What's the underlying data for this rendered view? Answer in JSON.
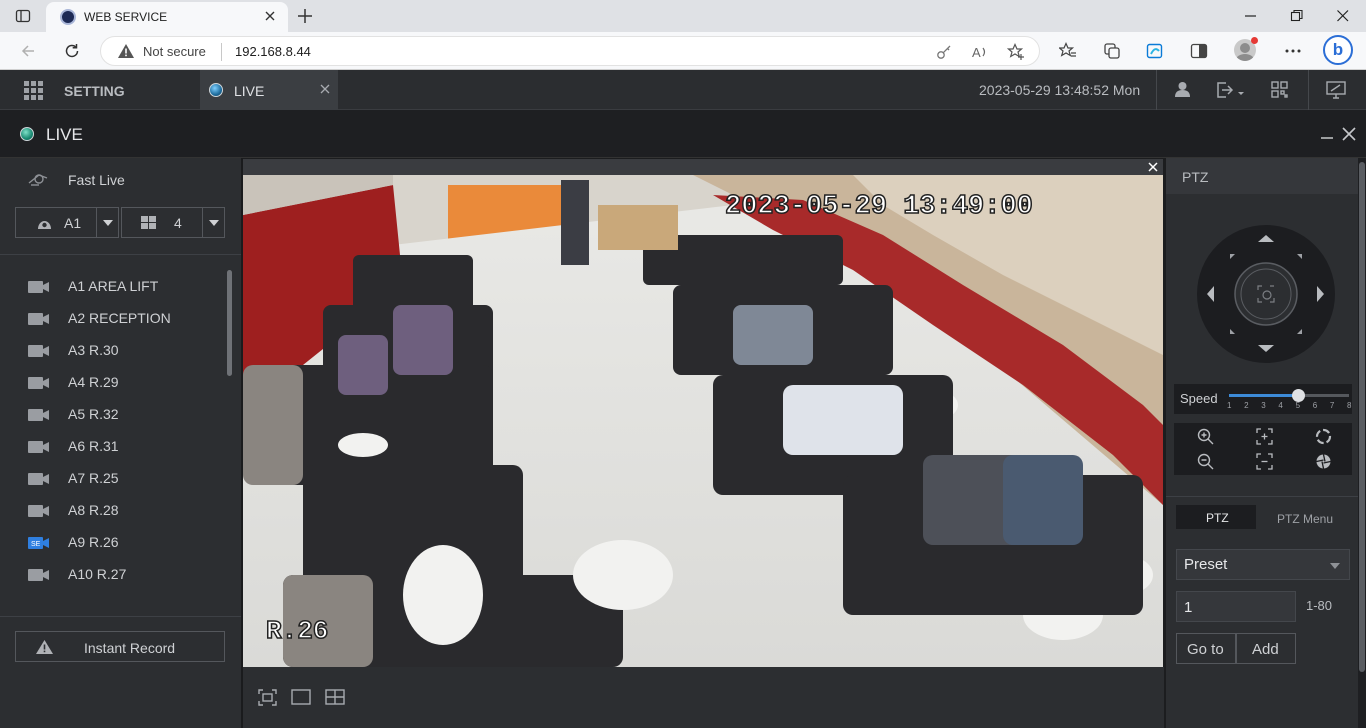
{
  "browser": {
    "tab_title": "WEB SERVICE",
    "security_label": "Not secure",
    "url": "192.168.8.44"
  },
  "app": {
    "setting_label": "SETTING",
    "live_tab_label": "LIVE",
    "datetime": "2023-05-29 13:48:52 Mon"
  },
  "live": {
    "title": "LIVE"
  },
  "left_panel": {
    "fast_live": "Fast Live",
    "area_select": "A1",
    "layout_select": "4",
    "cameras": [
      {
        "label": "A1 AREA LIFT",
        "active": false
      },
      {
        "label": "A2 RECEPTION",
        "active": false
      },
      {
        "label": "A3 R.30",
        "active": false
      },
      {
        "label": "A4 R.29",
        "active": false
      },
      {
        "label": "A5 R.32",
        "active": false
      },
      {
        "label": "A6 R.31",
        "active": false
      },
      {
        "label": "A7 R.25",
        "active": false
      },
      {
        "label": "A8 R.28",
        "active": false
      },
      {
        "label": "A9 R.26",
        "active": true
      },
      {
        "label": "A10 R.27",
        "active": false
      }
    ],
    "instant_record": "Instant Record"
  },
  "video": {
    "osd_datetime": "2023-05-29 13:49:00",
    "osd_channel": "R.26"
  },
  "ptz": {
    "title": "PTZ",
    "speed_label": "Speed",
    "speed_ticks": [
      "1",
      "2",
      "3",
      "4",
      "5",
      "6",
      "7",
      "8"
    ],
    "speed_value": 5,
    "tab_ptz": "PTZ",
    "tab_menu": "PTZ Menu",
    "preset_select": "Preset",
    "preset_value": "1",
    "preset_range": "1-80",
    "goto_label": "Go to",
    "add_label": "Add"
  },
  "colors": {
    "accent": "#3d8bd8",
    "active_cam": "#2f7fe0"
  }
}
